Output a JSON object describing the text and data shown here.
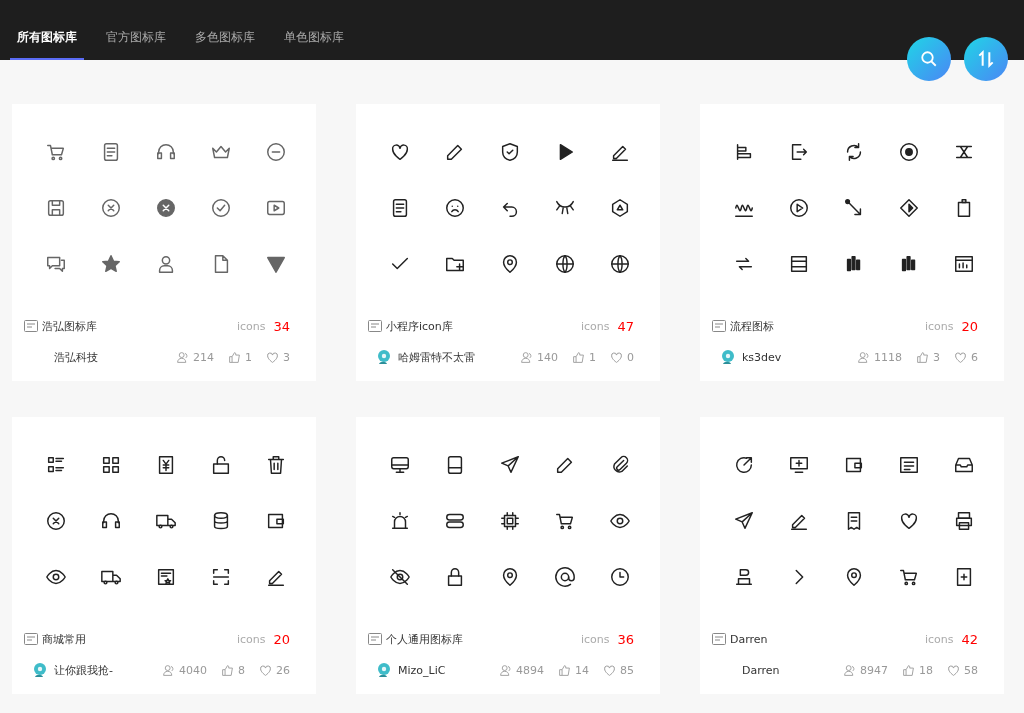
{
  "tabs": [
    {
      "label": "所有图标库",
      "selected": true
    },
    {
      "label": "官方图标库",
      "selected": false
    },
    {
      "label": "多色图标库",
      "selected": false
    },
    {
      "label": "单色图标库",
      "selected": false
    }
  ],
  "libraries": [
    {
      "name": "浩弘图标库",
      "count_label": "icons",
      "count": "34",
      "author": "浩弘科技",
      "avatar": false,
      "views": "214",
      "likes": "1",
      "favorites": "3"
    },
    {
      "name": "小程序icon库",
      "count_label": "icons",
      "count": "47",
      "author": "哈姆雷特不太雷",
      "avatar": true,
      "views": "140",
      "likes": "1",
      "favorites": "0"
    },
    {
      "name": "流程图标",
      "count_label": "icons",
      "count": "20",
      "author": "ks3dev",
      "avatar": true,
      "views": "1118",
      "likes": "3",
      "favorites": "6"
    },
    {
      "name": "商城常用",
      "count_label": "icons",
      "count": "20",
      "author": "让你跟我抢-",
      "avatar": true,
      "views": "4040",
      "likes": "8",
      "favorites": "26"
    },
    {
      "name": "个人通用图标库",
      "count_label": "icons",
      "count": "36",
      "author": "Mizo_LiC",
      "avatar": true,
      "views": "4894",
      "likes": "14",
      "favorites": "85"
    },
    {
      "name": "Darren",
      "count_label": "icons",
      "count": "42",
      "author": "Darren",
      "avatar": false,
      "views": "8947",
      "likes": "18",
      "favorites": "58"
    }
  ]
}
